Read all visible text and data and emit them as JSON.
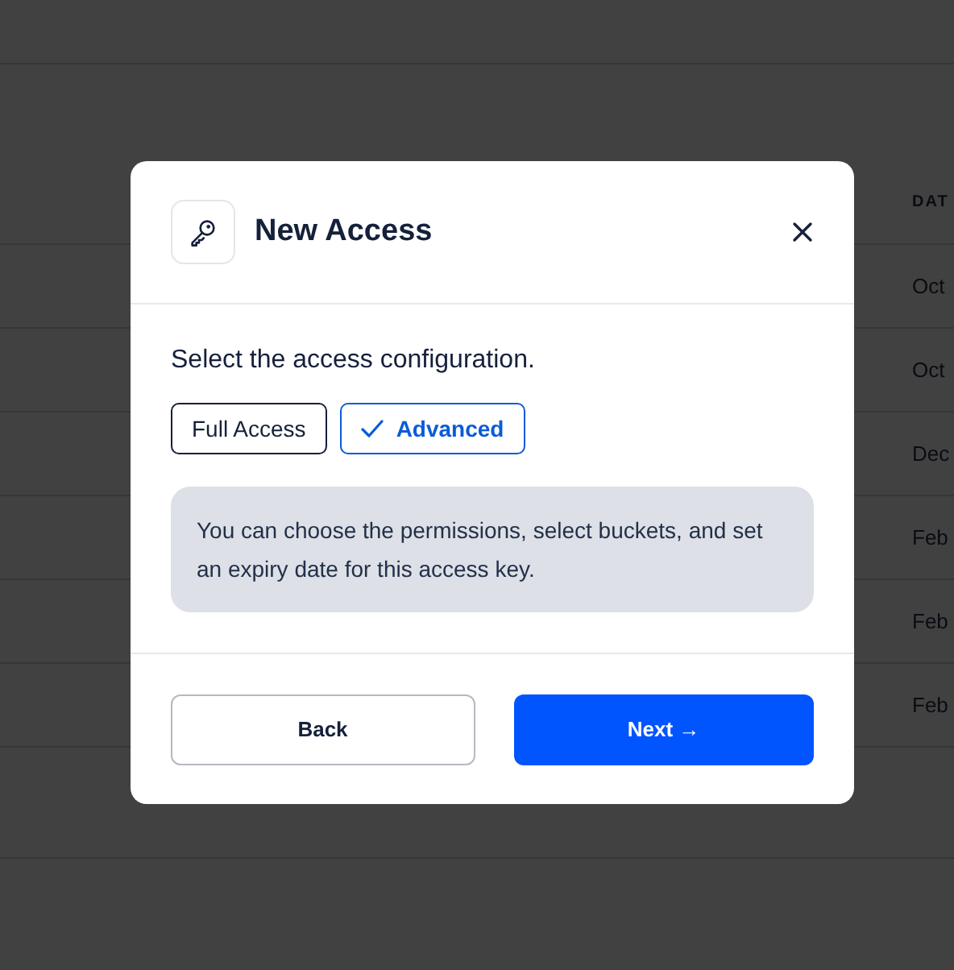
{
  "background_table": {
    "columns": [
      "DAT"
    ],
    "rows": [
      "Oct",
      "Oct",
      "Dec",
      "Feb",
      "Feb",
      "Feb"
    ]
  },
  "dialog": {
    "title": "New Access",
    "prompt": "Select the access configuration.",
    "options": [
      {
        "label": "Full Access",
        "selected": false
      },
      {
        "label": "Advanced",
        "selected": true
      }
    ],
    "info": "You can choose the permissions, select buckets, and set an expiry date for this access key.",
    "buttons": [
      {
        "label": "Back",
        "kind": "secondary"
      },
      {
        "label": "Next →",
        "kind": "primary"
      }
    ]
  }
}
